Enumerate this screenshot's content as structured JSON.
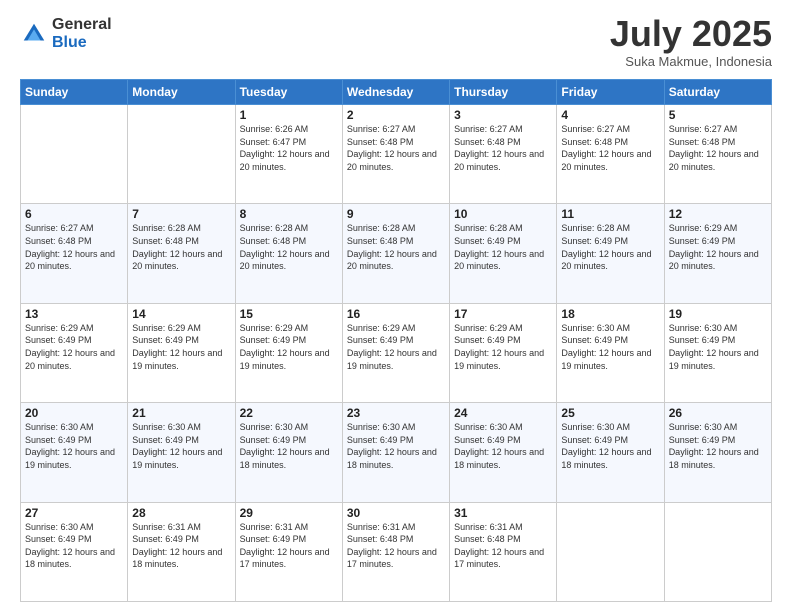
{
  "logo": {
    "general": "General",
    "blue": "Blue"
  },
  "header": {
    "month": "July 2025",
    "location": "Suka Makmue, Indonesia"
  },
  "days_of_week": [
    "Sunday",
    "Monday",
    "Tuesday",
    "Wednesday",
    "Thursday",
    "Friday",
    "Saturday"
  ],
  "weeks": [
    [
      {
        "day": "",
        "info": ""
      },
      {
        "day": "",
        "info": ""
      },
      {
        "day": "1",
        "sunrise": "6:26 AM",
        "sunset": "6:47 PM",
        "daylight": "12 hours and 20 minutes."
      },
      {
        "day": "2",
        "sunrise": "6:27 AM",
        "sunset": "6:48 PM",
        "daylight": "12 hours and 20 minutes."
      },
      {
        "day": "3",
        "sunrise": "6:27 AM",
        "sunset": "6:48 PM",
        "daylight": "12 hours and 20 minutes."
      },
      {
        "day": "4",
        "sunrise": "6:27 AM",
        "sunset": "6:48 PM",
        "daylight": "12 hours and 20 minutes."
      },
      {
        "day": "5",
        "sunrise": "6:27 AM",
        "sunset": "6:48 PM",
        "daylight": "12 hours and 20 minutes."
      }
    ],
    [
      {
        "day": "6",
        "sunrise": "6:27 AM",
        "sunset": "6:48 PM",
        "daylight": "12 hours and 20 minutes."
      },
      {
        "day": "7",
        "sunrise": "6:28 AM",
        "sunset": "6:48 PM",
        "daylight": "12 hours and 20 minutes."
      },
      {
        "day": "8",
        "sunrise": "6:28 AM",
        "sunset": "6:48 PM",
        "daylight": "12 hours and 20 minutes."
      },
      {
        "day": "9",
        "sunrise": "6:28 AM",
        "sunset": "6:48 PM",
        "daylight": "12 hours and 20 minutes."
      },
      {
        "day": "10",
        "sunrise": "6:28 AM",
        "sunset": "6:49 PM",
        "daylight": "12 hours and 20 minutes."
      },
      {
        "day": "11",
        "sunrise": "6:28 AM",
        "sunset": "6:49 PM",
        "daylight": "12 hours and 20 minutes."
      },
      {
        "day": "12",
        "sunrise": "6:29 AM",
        "sunset": "6:49 PM",
        "daylight": "12 hours and 20 minutes."
      }
    ],
    [
      {
        "day": "13",
        "sunrise": "6:29 AM",
        "sunset": "6:49 PM",
        "daylight": "12 hours and 20 minutes."
      },
      {
        "day": "14",
        "sunrise": "6:29 AM",
        "sunset": "6:49 PM",
        "daylight": "12 hours and 19 minutes."
      },
      {
        "day": "15",
        "sunrise": "6:29 AM",
        "sunset": "6:49 PM",
        "daylight": "12 hours and 19 minutes."
      },
      {
        "day": "16",
        "sunrise": "6:29 AM",
        "sunset": "6:49 PM",
        "daylight": "12 hours and 19 minutes."
      },
      {
        "day": "17",
        "sunrise": "6:29 AM",
        "sunset": "6:49 PM",
        "daylight": "12 hours and 19 minutes."
      },
      {
        "day": "18",
        "sunrise": "6:30 AM",
        "sunset": "6:49 PM",
        "daylight": "12 hours and 19 minutes."
      },
      {
        "day": "19",
        "sunrise": "6:30 AM",
        "sunset": "6:49 PM",
        "daylight": "12 hours and 19 minutes."
      }
    ],
    [
      {
        "day": "20",
        "sunrise": "6:30 AM",
        "sunset": "6:49 PM",
        "daylight": "12 hours and 19 minutes."
      },
      {
        "day": "21",
        "sunrise": "6:30 AM",
        "sunset": "6:49 PM",
        "daylight": "12 hours and 19 minutes."
      },
      {
        "day": "22",
        "sunrise": "6:30 AM",
        "sunset": "6:49 PM",
        "daylight": "12 hours and 18 minutes."
      },
      {
        "day": "23",
        "sunrise": "6:30 AM",
        "sunset": "6:49 PM",
        "daylight": "12 hours and 18 minutes."
      },
      {
        "day": "24",
        "sunrise": "6:30 AM",
        "sunset": "6:49 PM",
        "daylight": "12 hours and 18 minutes."
      },
      {
        "day": "25",
        "sunrise": "6:30 AM",
        "sunset": "6:49 PM",
        "daylight": "12 hours and 18 minutes."
      },
      {
        "day": "26",
        "sunrise": "6:30 AM",
        "sunset": "6:49 PM",
        "daylight": "12 hours and 18 minutes."
      }
    ],
    [
      {
        "day": "27",
        "sunrise": "6:30 AM",
        "sunset": "6:49 PM",
        "daylight": "12 hours and 18 minutes."
      },
      {
        "day": "28",
        "sunrise": "6:31 AM",
        "sunset": "6:49 PM",
        "daylight": "12 hours and 18 minutes."
      },
      {
        "day": "29",
        "sunrise": "6:31 AM",
        "sunset": "6:49 PM",
        "daylight": "12 hours and 17 minutes."
      },
      {
        "day": "30",
        "sunrise": "6:31 AM",
        "sunset": "6:48 PM",
        "daylight": "12 hours and 17 minutes."
      },
      {
        "day": "31",
        "sunrise": "6:31 AM",
        "sunset": "6:48 PM",
        "daylight": "12 hours and 17 minutes."
      },
      {
        "day": "",
        "info": ""
      },
      {
        "day": "",
        "info": ""
      }
    ]
  ]
}
